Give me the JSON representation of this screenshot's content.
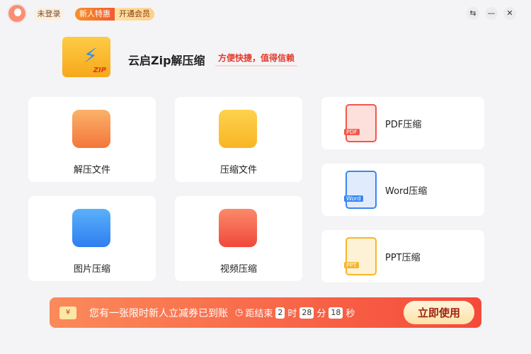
{
  "header": {
    "login": "未登录",
    "promo_new": "新人特惠",
    "promo_vip": "开通会员"
  },
  "window": {
    "settings": "⇆",
    "minimize": "—",
    "close": "✕"
  },
  "brand": {
    "title": "云启Zip解压缩",
    "slogan": "方便快捷，值得信赖",
    "logo_text": "ZIP"
  },
  "tools": [
    {
      "label": "解压文件"
    },
    {
      "label": "压缩文件"
    },
    {
      "label": "图片压缩"
    },
    {
      "label": "视频压缩"
    }
  ],
  "docs": [
    {
      "label": "PDF压缩",
      "tag": "PDF",
      "color": "#f0584a"
    },
    {
      "label": "Word压缩",
      "tag": "Word",
      "color": "#3a86f0"
    },
    {
      "label": "PPT压缩",
      "tag": "PPT",
      "color": "#f7b628"
    }
  ],
  "banner": {
    "ticket": "¥",
    "message": "您有一张限时新人立减券已到账",
    "countdown_label": "距结束",
    "hours": "2",
    "h_unit": "时",
    "minutes": "28",
    "m_unit": "分",
    "seconds": "18",
    "s_unit": "秒",
    "cta": "立即使用"
  }
}
